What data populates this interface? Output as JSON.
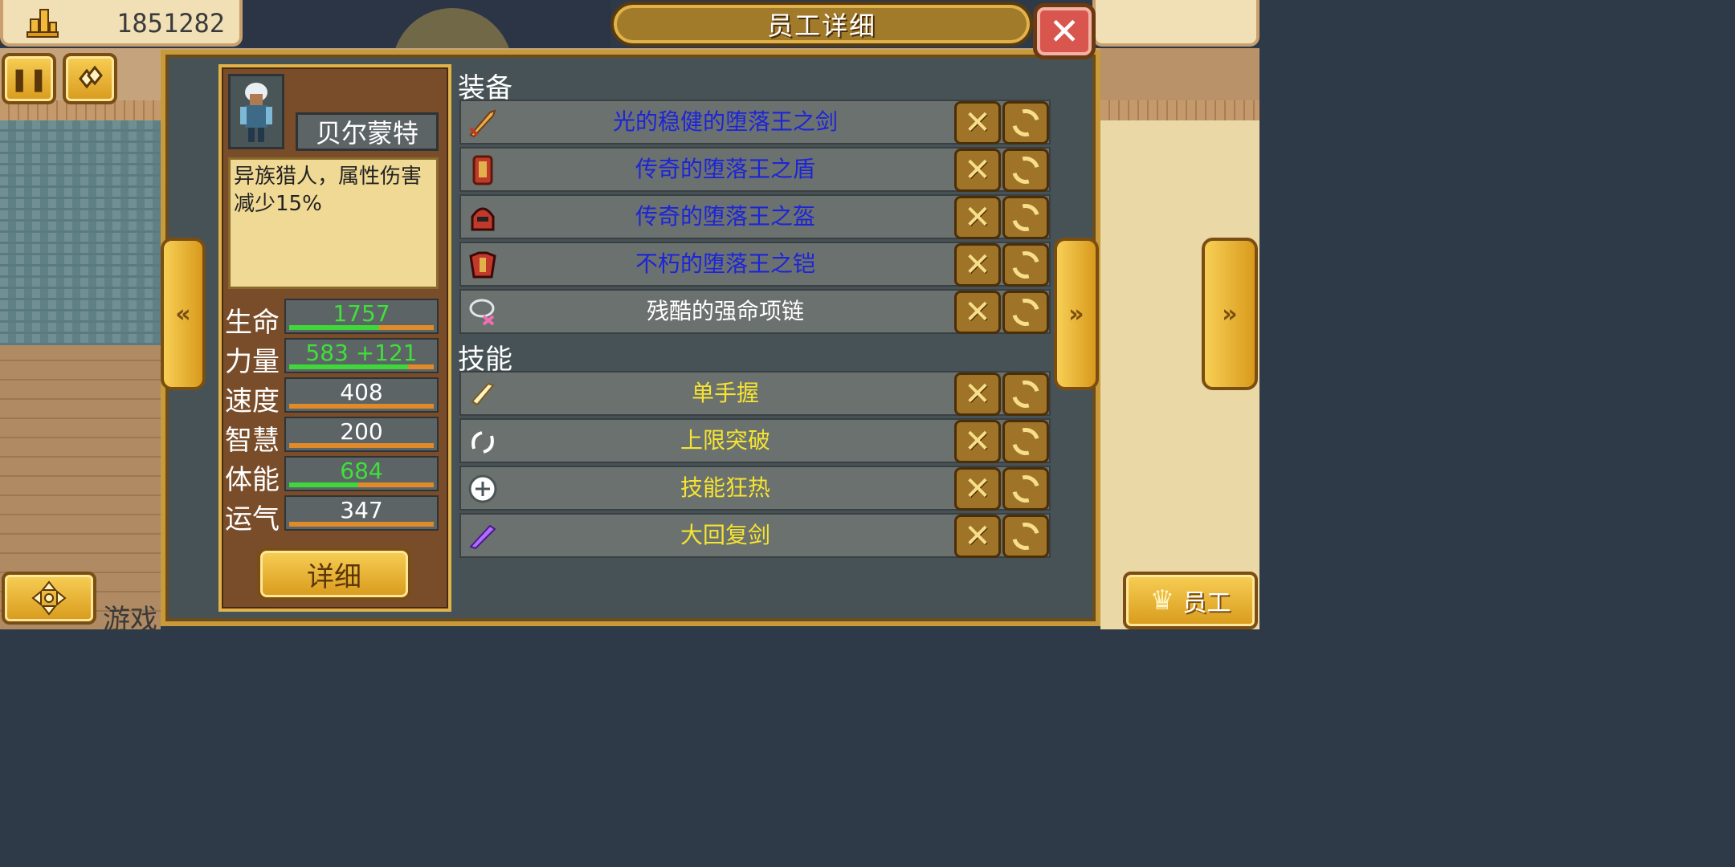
{
  "top_bar": {
    "money": "1851282"
  },
  "window": {
    "title": "员工详细"
  },
  "character": {
    "name": "贝尔蒙特",
    "description": "异族猎人，属性伤害减少15%"
  },
  "stats": [
    {
      "label": "生命",
      "value": "1757",
      "color": "green",
      "fill": 0.62
    },
    {
      "label": "力量",
      "value": "583 +121",
      "color": "green",
      "fill": 0.82
    },
    {
      "label": "速度",
      "value": "408",
      "color": "white",
      "fill": 0
    },
    {
      "label": "智慧",
      "value": "200",
      "color": "white",
      "fill": 0
    },
    {
      "label": "体能",
      "value": "684",
      "color": "green",
      "fill": 0.48
    },
    {
      "label": "运气",
      "value": "347",
      "color": "white",
      "fill": 0
    }
  ],
  "detail_button": {
    "label": "详细"
  },
  "equipment": {
    "title": "装备",
    "items": [
      {
        "name": "光的稳健的堕落王之剑",
        "color": "#1c24d8",
        "icon": "sword-icon"
      },
      {
        "name": "传奇的堕落王之盾",
        "color": "#1c24d8",
        "icon": "shield-icon"
      },
      {
        "name": "传奇的堕落王之盔",
        "color": "#1c24d8",
        "icon": "helmet-icon"
      },
      {
        "name": "不朽的堕落王之铠",
        "color": "#1c24d8",
        "icon": "armor-icon"
      },
      {
        "name": "残酷的强命项链",
        "color": "#ffffff",
        "icon": "necklace-icon"
      }
    ]
  },
  "skills": {
    "title": "技能",
    "items": [
      {
        "name": "单手握",
        "color": "#f5e431",
        "icon": "one-hand-grip-icon"
      },
      {
        "name": "上限突破",
        "color": "#f5e431",
        "icon": "limit-break-icon"
      },
      {
        "name": "技能狂热",
        "color": "#f5e431",
        "icon": "skill-frenzy-icon"
      },
      {
        "name": "大回复剑",
        "color": "#f5e431",
        "icon": "heal-sword-icon"
      }
    ]
  },
  "bottom": {
    "game_label": "游戏",
    "staff_button": "员工"
  }
}
